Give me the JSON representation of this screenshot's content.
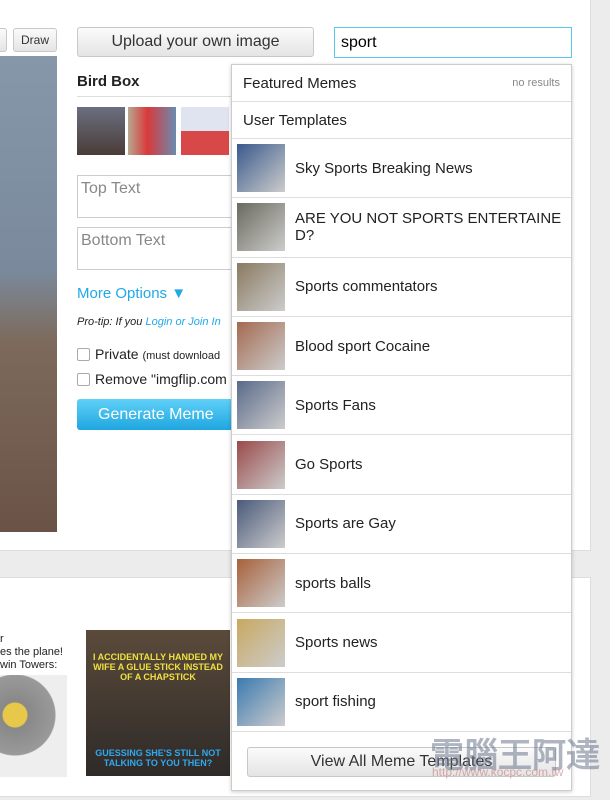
{
  "toolbar": {
    "draw_label": "Draw",
    "upload_label": "Upload your own image"
  },
  "search": {
    "value": "sport"
  },
  "editor": {
    "template_title": "Bird Box",
    "top_text_placeholder": "Top Text",
    "bottom_text_placeholder": "Bottom Text",
    "more_options": "More Options ▼",
    "protip_prefix": "Pro-tip: If you ",
    "protip_link": "Login or Join In",
    "private_label": "Private",
    "private_note": "(must download",
    "remove_label": "Remove \"imgflip.com",
    "generate_label": "Generate Meme"
  },
  "dropdown": {
    "featured": "Featured Memes",
    "no_results": "no results",
    "user_templates": "User Templates",
    "items": [
      {
        "label": "Sky Sports Breaking News",
        "color": "#3a5a8c"
      },
      {
        "label": "ARE YOU NOT SPORTS ENTERTAINED?",
        "color": "#6b6a5e"
      },
      {
        "label": "Sports commentators",
        "color": "#8a7a60"
      },
      {
        "label": "Blood sport Cocaine",
        "color": "#a46a50"
      },
      {
        "label": "Sports Fans",
        "color": "#5a6a8a"
      },
      {
        "label": "Go Sports",
        "color": "#9a4a4a"
      },
      {
        "label": "Sports are Gay",
        "color": "#4a5a7a"
      },
      {
        "label": "sports balls",
        "color": "#a8603a"
      },
      {
        "label": "Sports news",
        "color": "#c9a860"
      },
      {
        "label": "sport fishing",
        "color": "#3c7ab0"
      }
    ],
    "view_all": "View All Meme Templates"
  },
  "bottom": {
    "left_text": [
      "r",
      "es the plane!",
      "win Towers:"
    ],
    "meme_top": "I ACCIDENTALLY HANDED MY WIFE A GLUE STICK INSTEAD OF A CHAPSTICK",
    "meme_bottom": "GUESSING SHE'S STILL NOT TALKING TO YOU THEN?"
  },
  "watermark": {
    "text": "電腦王阿達",
    "url": "http://www.kocpc.com.tw"
  },
  "colors": {
    "accent": "#1fa6e0",
    "link": "#20a8e8"
  }
}
